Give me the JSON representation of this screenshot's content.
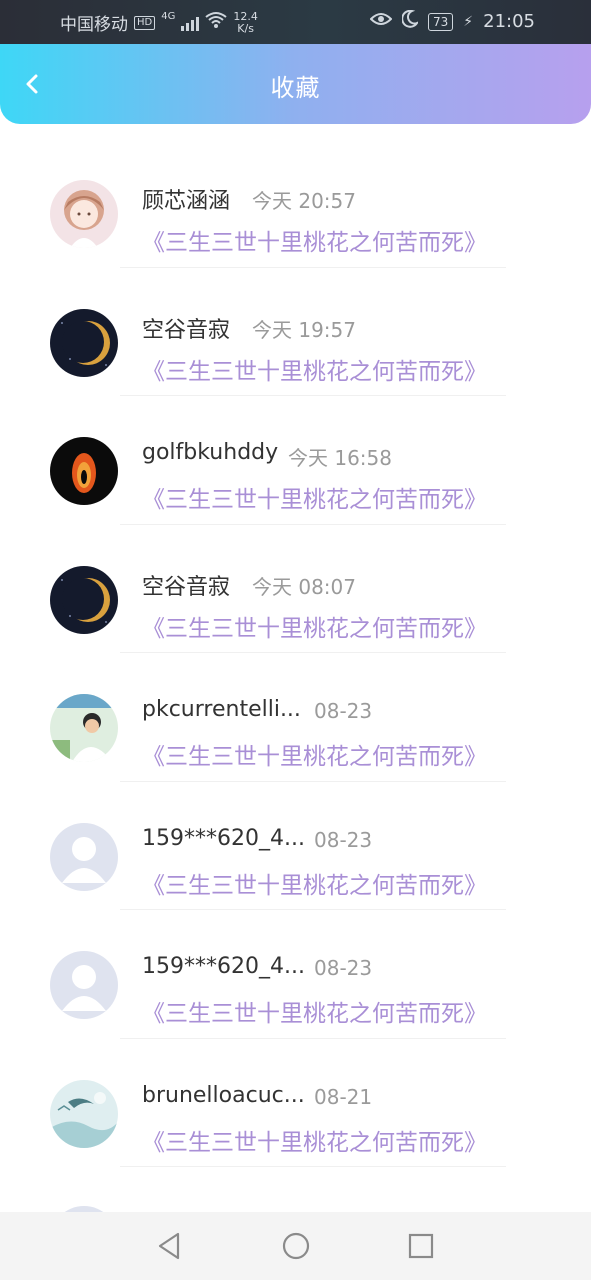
{
  "status_bar": {
    "carrier": "中国移动",
    "hd_badge": "HD",
    "network_type": "4G",
    "net_speed_value": "12.4",
    "net_speed_unit": "K/s",
    "battery": "73",
    "time": "21:05",
    "icons": [
      "signal-icon",
      "wifi-icon",
      "eye-icon",
      "moon-icon",
      "battery-icon",
      "charging-icon"
    ]
  },
  "header": {
    "title": "收藏",
    "back_icon": "chevron-left-icon"
  },
  "list": [
    {
      "name": "顾芯涵涵",
      "time": "今天 20:57",
      "novel": "《三生三世十里桃花之何苦而死》",
      "avatar": "anime-girl"
    },
    {
      "name": "空谷音寂",
      "time": "今天 19:57",
      "novel": "《三生三世十里桃花之何苦而死》",
      "avatar": "eclipse"
    },
    {
      "name": "golfbkuhddy",
      "time": "今天 16:58",
      "novel": "《三生三世十里桃花之何苦而死》",
      "avatar": "fire"
    },
    {
      "name": "空谷音寂",
      "time": "今天 08:07",
      "novel": "《三生三世十里桃花之何苦而死》",
      "avatar": "eclipse"
    },
    {
      "name": "pkcurrentelli...",
      "time": "08-23",
      "novel": "《三生三世十里桃花之何苦而死》",
      "avatar": "photo-person"
    },
    {
      "name": "159***620_4...",
      "time": "08-23",
      "novel": "《三生三世十里桃花之何苦而死》",
      "avatar": "default"
    },
    {
      "name": "159***620_4...",
      "time": "08-23",
      "novel": "《三生三世十里桃花之何苦而死》",
      "avatar": "default"
    },
    {
      "name": "brunelloacuc...",
      "time": "08-21",
      "novel": "《三生三世十里桃花之何苦而死》",
      "avatar": "landscape"
    }
  ],
  "nav_bar": {
    "icons": [
      "back-triangle-icon",
      "home-circle-icon",
      "recents-square-icon"
    ]
  },
  "colors": {
    "header_gradient_start": "#3ed7f6",
    "header_gradient_end": "#b7a0ee",
    "novel_title": "#a98fd6",
    "name_text": "#333333",
    "time_text": "#9a9a9a"
  }
}
